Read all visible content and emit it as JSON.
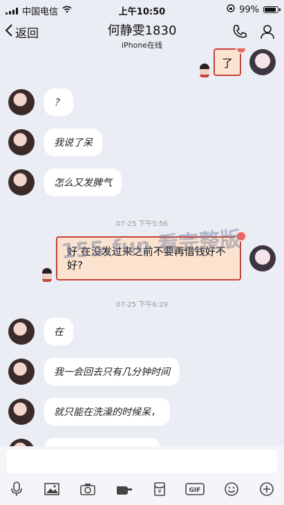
{
  "status_bar": {
    "carrier": "中国电信",
    "time": "上午10:50",
    "battery": "99%",
    "battery_level": 0.99
  },
  "header": {
    "back_label": "返回",
    "title": "何静雯1830",
    "subtitle": "iPhone在线"
  },
  "messages": [
    {
      "text": "了"
    },
    {
      "text": "？"
    },
    {
      "text": "我说了呆"
    },
    {
      "text": "怎么又发脾气"
    },
    {
      "text": "好 在没发过来之前不要再借钱好不好?"
    },
    {
      "text": "在"
    },
    {
      "text": "我一会回去只有几分钟时间"
    },
    {
      "text": "就只能在洗澡的时候呆，"
    }
  ],
  "timestamps": [
    "07-25 下午5:56",
    "07-25 下午6:29"
  ],
  "watermark": "155.fun 看完整版"
}
